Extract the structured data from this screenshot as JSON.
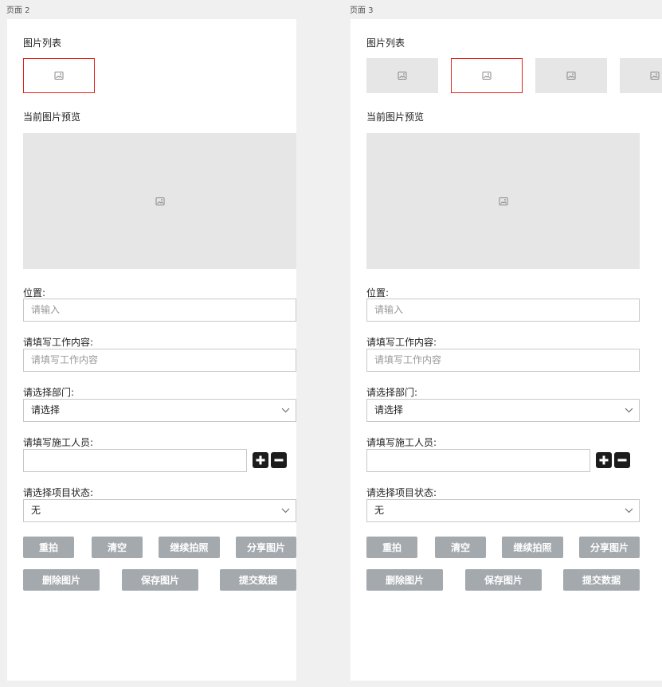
{
  "pages": [
    {
      "page_label": "页面 2",
      "image_list_label": "图片列表",
      "current_preview_label": "当前图片预览",
      "location": {
        "label": "位置:",
        "placeholder": "请输入"
      },
      "work_content": {
        "label": "请填写工作内容:",
        "placeholder": "请填写工作内容"
      },
      "department": {
        "label": "请选择部门:",
        "value": "请选择"
      },
      "workers": {
        "label": "请填写施工人员:",
        "value": ""
      },
      "project_status": {
        "label": "请选择项目状态:",
        "value": "无"
      },
      "buttons": {
        "retake": "重拍",
        "clear": "清空",
        "continue_shoot": "继续拍照",
        "share_image": "分享图片",
        "delete_image": "删除图片",
        "save_image": "保存图片",
        "submit_data": "提交数据"
      }
    },
    {
      "page_label": "页面 3",
      "image_list_label": "图片列表",
      "current_preview_label": "当前图片预览",
      "location": {
        "label": "位置:",
        "placeholder": "请输入"
      },
      "work_content": {
        "label": "请填写工作内容:",
        "placeholder": "请填写工作内容"
      },
      "department": {
        "label": "请选择部门:",
        "value": "请选择"
      },
      "workers": {
        "label": "请填写施工人员:",
        "value": ""
      },
      "project_status": {
        "label": "请选择项目状态:",
        "value": "无"
      },
      "buttons": {
        "retake": "重拍",
        "clear": "清空",
        "continue_shoot": "继续拍照",
        "share_image": "分享图片",
        "delete_image": "删除图片",
        "save_image": "保存图片",
        "submit_data": "提交数据"
      }
    }
  ],
  "colors": {
    "selected_border": "#e0231c",
    "button_bg": "#a4a9ae",
    "placeholder_bg": "#e6e6e6",
    "icon_button_bg": "#1c1c1c"
  },
  "icons": {
    "thumbnail": "image-icon",
    "dropdown": "chevron-down-icon",
    "add": "plus-icon",
    "remove": "minus-icon"
  }
}
